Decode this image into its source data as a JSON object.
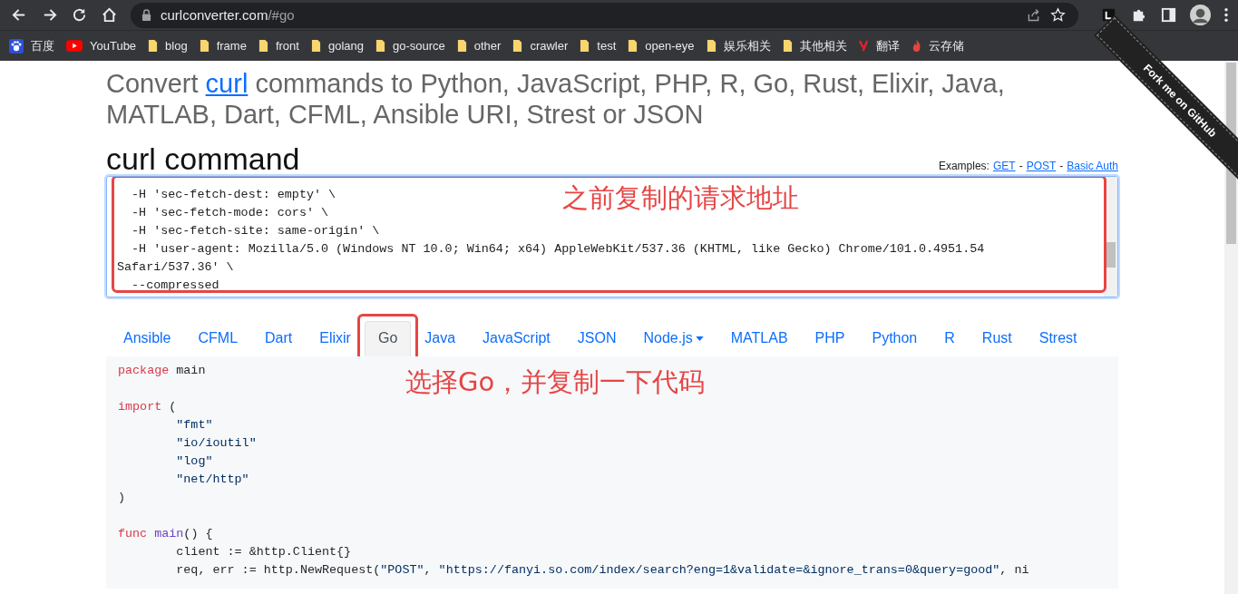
{
  "browser": {
    "url_host": "curlconverter.com",
    "url_path": "/#go",
    "bookmarks": [
      {
        "label": "百度",
        "kind": "baidu"
      },
      {
        "label": "YouTube",
        "kind": "youtube"
      },
      {
        "label": "blog",
        "kind": "folder"
      },
      {
        "label": "frame",
        "kind": "folder"
      },
      {
        "label": "front",
        "kind": "folder"
      },
      {
        "label": "golang",
        "kind": "folder"
      },
      {
        "label": "go-source",
        "kind": "folder"
      },
      {
        "label": "other",
        "kind": "folder"
      },
      {
        "label": "crawler",
        "kind": "folder"
      },
      {
        "label": "test",
        "kind": "folder"
      },
      {
        "label": "open-eye",
        "kind": "folder"
      },
      {
        "label": "娱乐相关",
        "kind": "folder"
      },
      {
        "label": "其他相关",
        "kind": "folder"
      },
      {
        "label": "翻译",
        "kind": "translate"
      },
      {
        "label": "云存储",
        "kind": "flame"
      }
    ]
  },
  "heading": {
    "before": "Convert ",
    "link": "curl",
    "after": " commands to Python, JavaScript, PHP, R, Go, Rust, Elixir, Java, MATLAB, Dart, CFML, Ansible URI, Strest or JSON"
  },
  "ribbon": "Fork me on GitHub",
  "section_title": "curl command",
  "examples": {
    "label": "Examples:",
    "separator": "-",
    "links": [
      "GET",
      "POST",
      "Basic Auth"
    ]
  },
  "curl_input": [
    "  -H 'sec-fetch-dest: empty' \\",
    "  -H 'sec-fetch-mode: cors' \\",
    "  -H 'sec-fetch-site: same-origin' \\",
    "  -H 'user-agent: Mozilla/5.0 (Windows NT 10.0; Win64; x64) AppleWebKit/537.36 (KHTML, like Gecko) Chrome/101.0.4951.54 Safari/537.36' \\",
    "  --compressed"
  ],
  "tabs": [
    {
      "label": "Ansible",
      "selected": false,
      "dropdown": false
    },
    {
      "label": "CFML",
      "selected": false,
      "dropdown": false
    },
    {
      "label": "Dart",
      "selected": false,
      "dropdown": false
    },
    {
      "label": "Elixir",
      "selected": false,
      "dropdown": false
    },
    {
      "label": "Go",
      "selected": true,
      "dropdown": false
    },
    {
      "label": "Java",
      "selected": false,
      "dropdown": false
    },
    {
      "label": "JavaScript",
      "selected": false,
      "dropdown": false
    },
    {
      "label": "JSON",
      "selected": false,
      "dropdown": false
    },
    {
      "label": "Node.js",
      "selected": false,
      "dropdown": true
    },
    {
      "label": "MATLAB",
      "selected": false,
      "dropdown": false
    },
    {
      "label": "PHP",
      "selected": false,
      "dropdown": false
    },
    {
      "label": "Python",
      "selected": false,
      "dropdown": false
    },
    {
      "label": "R",
      "selected": false,
      "dropdown": false
    },
    {
      "label": "Rust",
      "selected": false,
      "dropdown": false
    },
    {
      "label": "Strest",
      "selected": false,
      "dropdown": false
    }
  ],
  "code": [
    [
      [
        {
          "text": "package",
          "kind": "keyword"
        },
        {
          "text": " main",
          "kind": "plain"
        }
      ]
    ],
    [
      [
        {
          "text": "import",
          "kind": "keyword"
        },
        {
          "text": " (",
          "kind": "plain"
        }
      ],
      [
        {
          "text": "        \"fmt\"",
          "kind": "string"
        }
      ],
      [
        {
          "text": "        \"io/ioutil\"",
          "kind": "string"
        }
      ],
      [
        {
          "text": "        \"log\"",
          "kind": "string"
        }
      ],
      [
        {
          "text": "        \"net/http\"",
          "kind": "string"
        }
      ],
      [
        {
          "text": ")",
          "kind": "plain"
        }
      ]
    ],
    [
      [
        {
          "text": "func",
          "kind": "keyword"
        },
        {
          "text": " main",
          "kind": "function"
        },
        {
          "text": "() {",
          "kind": "plain"
        }
      ],
      [
        {
          "text": "        client := &http.Client{}",
          "kind": "plain"
        }
      ],
      [
        {
          "text": "        req, err := http.NewRequest(",
          "kind": "plain"
        },
        {
          "text": "\"POST\"",
          "kind": "string"
        },
        {
          "text": ", ",
          "kind": "plain"
        },
        {
          "text": "\"https://fanyi.so.com/index/search?eng=1&validate=&ignore_trans=0&query=good\"",
          "kind": "string"
        },
        {
          "text": ", ni",
          "kind": "plain"
        }
      ]
    ]
  ],
  "annotations": [
    {
      "text": "之前复制的请求地址"
    },
    {
      "text": "选择Go，并复制一下代码"
    }
  ]
}
